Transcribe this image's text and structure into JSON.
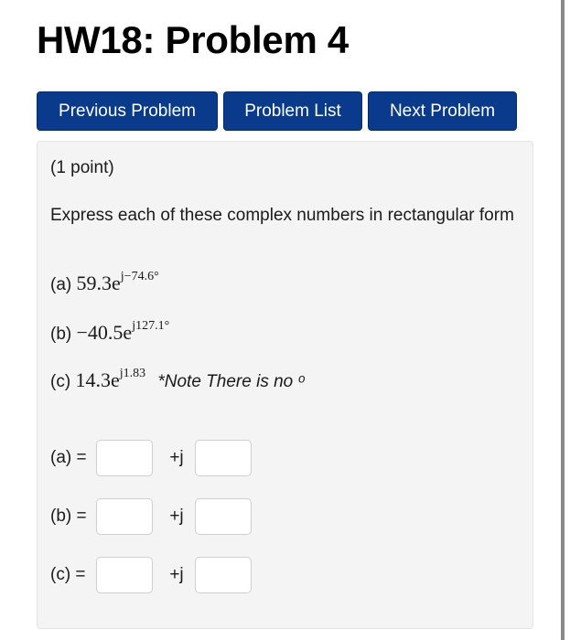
{
  "page": {
    "title": "HW18: Problem 4"
  },
  "nav": {
    "previous_label": "Previous Problem",
    "list_label": "Problem List",
    "next_label": "Next Problem"
  },
  "problem": {
    "points": "(1 point)",
    "prompt": "Express each of these complex numbers in rectangular form",
    "parts": [
      {
        "label": "(a)",
        "base": "59.3e",
        "exponent": "j−74.6°",
        "note": ""
      },
      {
        "label": "(b)",
        "base": "−40.5e",
        "exponent": "j127.1°",
        "note": ""
      },
      {
        "label": "(c)",
        "base": "14.3e",
        "exponent": "j1.83",
        "note": "*Note There is no ᵒ"
      }
    ],
    "answers": [
      {
        "label": "(a) =",
        "joiner": "+j",
        "real_value": "",
        "imag_value": ""
      },
      {
        "label": "(b) =",
        "joiner": "+j",
        "real_value": "",
        "imag_value": ""
      },
      {
        "label": "(c) =",
        "joiner": "+j",
        "real_value": "",
        "imag_value": ""
      }
    ]
  }
}
